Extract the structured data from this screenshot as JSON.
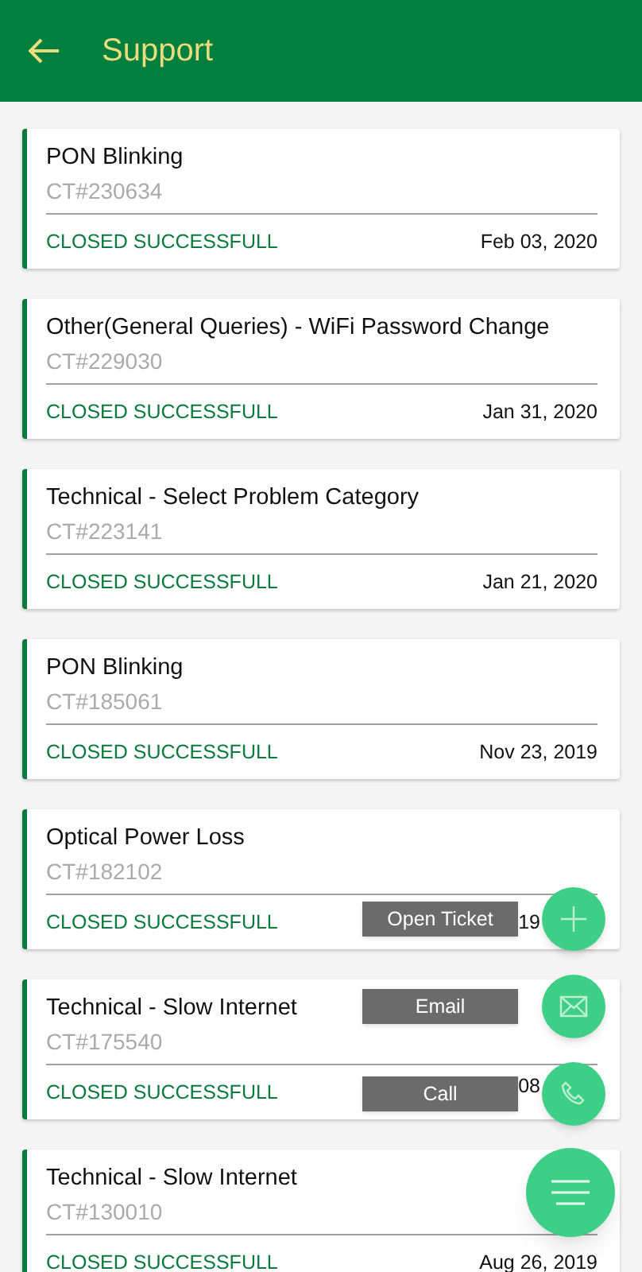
{
  "app_bar": {
    "title": "Support"
  },
  "tickets": [
    {
      "title": "PON Blinking",
      "id": "CT#230634",
      "status": "CLOSED SUCCESSFULL",
      "date": "Feb 03, 2020"
    },
    {
      "title": "Other(General Queries)  - WiFi Password Change",
      "id": "CT#229030",
      "status": "CLOSED SUCCESSFULL",
      "date": "Jan 31, 2020"
    },
    {
      "title": "Technical - Select Problem Category",
      "id": "CT#223141",
      "status": "CLOSED SUCCESSFULL",
      "date": "Jan 21, 2020"
    },
    {
      "title": "PON Blinking",
      "id": "CT#185061",
      "status": "CLOSED SUCCESSFULL",
      "date": "Nov 23, 2019"
    },
    {
      "title": "Optical Power Loss",
      "id": "CT#182102",
      "status": "CLOSED SUCCESSFULL",
      "date": "19"
    },
    {
      "title": "Technical - Slow Internet",
      "id": "CT#175540",
      "status": "CLOSED SUCCESSFULL",
      "date": "08"
    },
    {
      "title": "Technical - Slow Internet",
      "id": "CT#130010",
      "status": "CLOSED SUCCESSFULL",
      "date": "Aug 26, 2019"
    }
  ],
  "fab_actions": [
    {
      "label": "Open Ticket",
      "kind": "plus"
    },
    {
      "label": "Email",
      "kind": "mail"
    },
    {
      "label": "Call",
      "kind": "phone"
    }
  ]
}
